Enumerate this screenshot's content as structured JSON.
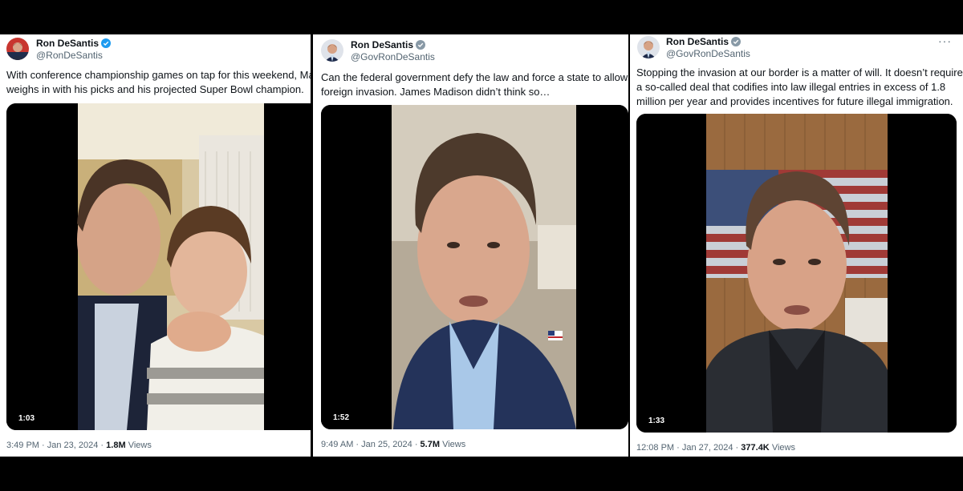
{
  "colors": {
    "badge_blue": "#1d9bf0",
    "text": "#0f1419",
    "muted": "#536471"
  },
  "tweets": [
    {
      "name": "Ron DeSantis",
      "handle": "@RonDeSantis",
      "text_line1": "With conference championship games on tap for this weekend, Mas",
      "text_line2": "weighs in with his picks and his projected Super Bowl champion.",
      "duration": "1:03",
      "time": "3:49 PM",
      "date": "Jan 23, 2024",
      "views_count": "1.8M",
      "views_label": "Views",
      "icon": "verified-badge-icon"
    },
    {
      "name": "Ron DeSantis",
      "handle": "@GovRonDeSantis",
      "text_line1": "Can the federal government defy the law and force a state to allow a",
      "text_line2": "foreign invasion.  James Madison didn’t think so…",
      "duration": "1:52",
      "time": "9:49 AM",
      "date": "Jan 25, 2024",
      "views_count": "5.7M",
      "views_label": "Views",
      "icon": "verified-badge-icon"
    },
    {
      "name": "Ron DeSantis",
      "handle": "@GovRonDeSantis",
      "text_line1": "Stopping the invasion at our border is a matter of will.  It doesn’t require",
      "text_line2": "a so-called deal that codifies into law illegal entries in excess of 1.8",
      "text_line3": "million per year and provides incentives for future illegal immigration.",
      "duration": "1:33",
      "time": "12:08 PM",
      "date": "Jan 27, 2024",
      "views_count": "377.4K",
      "views_label": "Views",
      "more": "···",
      "icon": "verified-badge-icon"
    }
  ]
}
